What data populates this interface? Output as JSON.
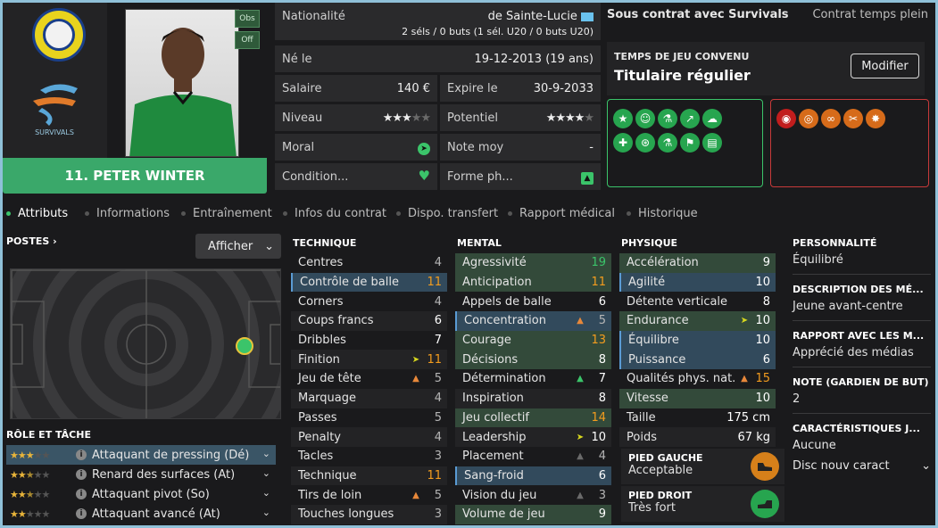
{
  "player": {
    "name": "11. PETER WINTER",
    "obs": "Obs",
    "off": "Off",
    "club_text": "SURVIVALS"
  },
  "info": {
    "nationality_label": "Nationalité",
    "nationality_value": "de Sainte-Lucie",
    "caps": "2 séls / 0 buts (1 sél. U20 / 0 buts U20)",
    "born_label": "Né le",
    "born_value": "19-12-2013 (19 ans)",
    "salary_label": "Salaire",
    "salary_value": "140 €",
    "expires_label": "Expire le",
    "expires_value": "30-9-2033",
    "level_label": "Niveau",
    "level_stars": 3,
    "potential_label": "Potentiel",
    "potential_stars": 4,
    "morale_label": "Moral",
    "avg_label": "Note moy",
    "avg_value": "-",
    "condition_label": "Condition...",
    "form_label": "Forme ph..."
  },
  "contract": {
    "status": "Sous contrat avec Survivals",
    "type": "Contrat temps plein",
    "playing_time_label": "TEMPS DE JEU CONVENU",
    "playing_time_value": "Titulaire régulier",
    "modify_button": "Modifier"
  },
  "traits_positive": [
    "star-icon",
    "smile-icon",
    "flask-icon",
    "trend-up-icon",
    "brain-icon",
    "bandage-icon",
    "circles-icon",
    "flask-icon",
    "flag-icon",
    "clipboard-icon"
  ],
  "traits_negative": [
    "eye-icon",
    "target-icon",
    "chain-icon",
    "scissors-icon",
    "burst-icon"
  ],
  "tabs": [
    {
      "label": "Attributs",
      "active": true
    },
    {
      "label": "Informations"
    },
    {
      "label": "Entraînement"
    },
    {
      "label": "Infos du contrat"
    },
    {
      "label": "Dispo. transfert"
    },
    {
      "label": "Rapport médical"
    },
    {
      "label": "Historique"
    }
  ],
  "positions": {
    "title": "POSTES",
    "display_button": "Afficher"
  },
  "roles": {
    "title": "RÔLE ET TÂCHE",
    "items": [
      {
        "stars": 3,
        "half": false,
        "label": "Attaquant de pressing (Dé)"
      },
      {
        "stars": 2,
        "half": true,
        "label": "Renard des surfaces (At)"
      },
      {
        "stars": 2,
        "half": true,
        "label": "Attaquant pivot (So)"
      },
      {
        "stars": 2,
        "half": false,
        "label": "Attaquant avancé (At)"
      }
    ]
  },
  "technique": {
    "title": "TECHNIQUE",
    "items": [
      {
        "n": "Centres",
        "v": "4"
      },
      {
        "n": "Contrôle de balle",
        "v": "11"
      },
      {
        "n": "Corners",
        "v": "4"
      },
      {
        "n": "Coups francs",
        "v": "6"
      },
      {
        "n": "Dribbles",
        "v": "7"
      },
      {
        "n": "Finition",
        "v": "11"
      },
      {
        "n": "Jeu de tête",
        "v": "5"
      },
      {
        "n": "Marquage",
        "v": "4"
      },
      {
        "n": "Passes",
        "v": "5"
      },
      {
        "n": "Penalty",
        "v": "4"
      },
      {
        "n": "Tacles",
        "v": "3"
      },
      {
        "n": "Technique",
        "v": "11"
      },
      {
        "n": "Tirs de loin",
        "v": "5"
      },
      {
        "n": "Touches longues",
        "v": "3"
      }
    ]
  },
  "mental": {
    "title": "MENTAL",
    "items": [
      {
        "n": "Agressivité",
        "v": "19"
      },
      {
        "n": "Anticipation",
        "v": "11"
      },
      {
        "n": "Appels de balle",
        "v": "6"
      },
      {
        "n": "Concentration",
        "v": "5"
      },
      {
        "n": "Courage",
        "v": "13"
      },
      {
        "n": "Décisions",
        "v": "8"
      },
      {
        "n": "Détermination",
        "v": "7"
      },
      {
        "n": "Inspiration",
        "v": "8"
      },
      {
        "n": "Jeu collectif",
        "v": "14"
      },
      {
        "n": "Leadership",
        "v": "10"
      },
      {
        "n": "Placement",
        "v": "4"
      },
      {
        "n": "Sang-froid",
        "v": "6"
      },
      {
        "n": "Vision du jeu",
        "v": "3"
      },
      {
        "n": "Volume de jeu",
        "v": "9"
      }
    ]
  },
  "physical": {
    "title": "PHYSIQUE",
    "items": [
      {
        "n": "Accélération",
        "v": "9"
      },
      {
        "n": "Agilité",
        "v": "10"
      },
      {
        "n": "Détente verticale",
        "v": "8"
      },
      {
        "n": "Endurance",
        "v": "10"
      },
      {
        "n": "Équilibre",
        "v": "10"
      },
      {
        "n": "Puissance",
        "v": "6"
      },
      {
        "n": "Qualités phys. nat.",
        "v": "15"
      },
      {
        "n": "Vitesse",
        "v": "10"
      },
      {
        "n": "Taille",
        "v": "175 cm"
      },
      {
        "n": "Poids",
        "v": "67 kg"
      }
    ]
  },
  "feet": {
    "left_label": "PIED GAUCHE",
    "left_value": "Acceptable",
    "right_label": "PIED DROIT",
    "right_value": "Très fort"
  },
  "side": {
    "personality_label": "PERSONNALITÉ",
    "personality_value": "Équilibré",
    "media_label": "DESCRIPTION DES MÉ...",
    "media_value": "Jeune avant-centre",
    "press_label": "RAPPORT AVEC LES M...",
    "press_value": "Apprécié des médias",
    "gk_label": "NOTE (GARDIEN DE BUT)",
    "gk_value": "2",
    "traits_label": "CARACTÉRISTIQUES J...",
    "traits_value": "Aucune",
    "traits_button": "Disc nouv caract"
  },
  "colors": {
    "accent": "#3bc46a",
    "good_border": "#3bc46a",
    "bad_border": "#c83a3a",
    "name_bar": "#3aa86a",
    "star": "#e8b43a"
  }
}
